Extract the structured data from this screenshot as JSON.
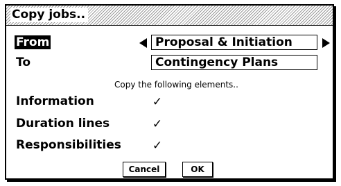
{
  "dialog": {
    "title": "Copy jobs..",
    "from": {
      "label": "From",
      "value": "Proposal & Initiation"
    },
    "to": {
      "label": "To",
      "value": "Contingency Plans"
    },
    "hint": "Copy the following elements..",
    "options": [
      {
        "label": "Information",
        "check": "✓"
      },
      {
        "label": "Duration lines",
        "check": "✓"
      },
      {
        "label": "Responsibilities",
        "check": "✓"
      }
    ],
    "buttons": {
      "cancel": "Cancel",
      "ok": "OK"
    }
  },
  "icons": {
    "prev": "left-arrow-icon",
    "next": "right-arrow-icon"
  }
}
